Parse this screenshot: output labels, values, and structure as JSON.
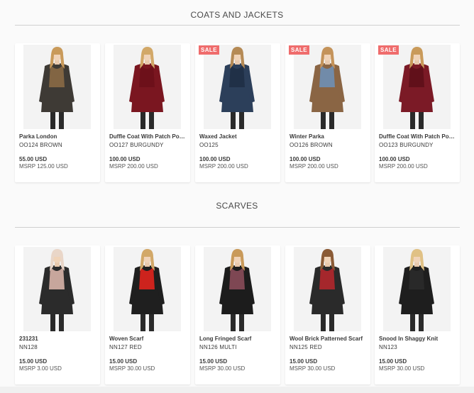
{
  "sections": [
    {
      "title": "COATS AND JACKETS",
      "products": [
        {
          "name": "Parka London",
          "sku": "OO124 BROWN",
          "price": "55.00 USD",
          "msrp": "MSRP 125.00 USD",
          "sale": "",
          "bg": "#f3f3f3",
          "garment": "#3e3a35",
          "hair": "#c99a5a",
          "trim": "#8a6a45"
        },
        {
          "name": "Duffle Coat With Patch Pockets",
          "sku": "OO127 BURGUNDY",
          "price": "100.00 USD",
          "msrp": "MSRP 200.00 USD",
          "sale": "",
          "bg": "#f3f3f3",
          "garment": "#7a1620",
          "hair": "#d2a868",
          "trim": "#6b1019"
        },
        {
          "name": "Waxed Jacket",
          "sku": "OO125",
          "price": "100.00 USD",
          "msrp": "MSRP 200.00 USD",
          "sale": "SALE",
          "bg": "#f3f3f3",
          "garment": "#2c3f5a",
          "hair": "#b58a55",
          "trim": "#1f2f45"
        },
        {
          "name": "Winter Parka",
          "sku": "OO126 BROWN",
          "price": "100.00 USD",
          "msrp": "MSRP 200.00 USD",
          "sale": "SALE",
          "bg": "#f3f3f3",
          "garment": "#8a6544",
          "hair": "#c4935a",
          "trim": "#6e8fb5"
        },
        {
          "name": "Duffle Coat With Patch Pockets",
          "sku": "OO123 BURGUNDY",
          "price": "100.00 USD",
          "msrp": "MSRP 200.00 USD",
          "sale": "SALE",
          "bg": "#f3f3f3",
          "garment": "#7b1a26",
          "hair": "#c99a5a",
          "trim": "#5e1019"
        }
      ]
    },
    {
      "title": "SCARVES",
      "products": [
        {
          "name": "231231",
          "sku": "NN128",
          "price": "15.00 USD",
          "msrp": "MSRP 3.00 USD",
          "sale": "",
          "bg": "#f3f3f3",
          "garment": "#2b2b2b",
          "hair": "#e9d6c8",
          "trim": "#d8b4a8"
        },
        {
          "name": "Woven Scarf",
          "sku": "NN127 RED",
          "price": "15.00 USD",
          "msrp": "MSRP 30.00 USD",
          "sale": "",
          "bg": "#f3f3f3",
          "garment": "#1f1f1f",
          "hair": "#d2a868",
          "trim": "#e0241d"
        },
        {
          "name": "Long Fringed Scarf",
          "sku": "NN126 MULTI",
          "price": "15.00 USD",
          "msrp": "MSRP 30.00 USD",
          "sale": "",
          "bg": "#f3f3f3",
          "garment": "#1c1c1c",
          "hair": "#c99a5a",
          "trim": "#8a4d5a"
        },
        {
          "name": "Wool Brick Patterned Scarf",
          "sku": "NN125 RED",
          "price": "15.00 USD",
          "msrp": "MSRP 30.00 USD",
          "sale": "",
          "bg": "#f3f3f3",
          "garment": "#2a2a2a",
          "hair": "#8a5a35",
          "trim": "#b3272c"
        },
        {
          "name": "Snood In Shaggy Knit",
          "sku": "NN123",
          "price": "15.00 USD",
          "msrp": "MSRP 30.00 USD",
          "sale": "",
          "bg": "#f3f3f3",
          "garment": "#1e1e1e",
          "hair": "#e0c185",
          "trim": "#2a2a2a"
        }
      ]
    }
  ]
}
